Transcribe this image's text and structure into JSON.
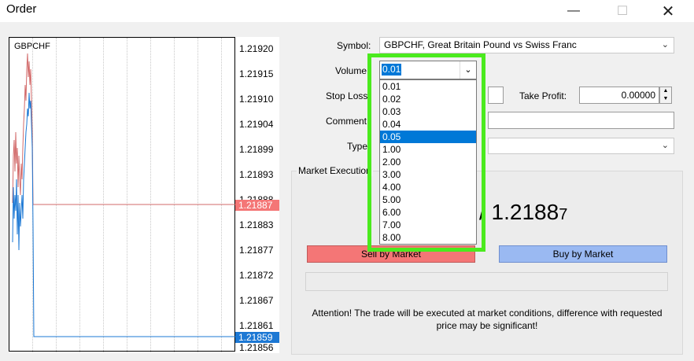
{
  "window": {
    "title": "Order",
    "minimize_icon": "minimize-icon",
    "maximize_icon": "maximize-icon",
    "close_icon": "close-icon"
  },
  "chart": {
    "symbol": "GBPCHF",
    "price_ticks": [
      "1.21920",
      "1.21915",
      "1.21910",
      "1.21904",
      "1.21899",
      "1.21893",
      "1.21888",
      "1.21883",
      "1.21877",
      "1.21872",
      "1.21867",
      "1.21861",
      "1.21856"
    ],
    "ask_tag": "1.21887",
    "bid_tag": "1.21859",
    "colors": {
      "ask": "#f47676",
      "bid": "#1c78d4"
    }
  },
  "form": {
    "symbol_label": "Symbol:",
    "symbol_value": "GBPCHF, Great Britain Pound vs Swiss Franc",
    "volume_label": "Volume:",
    "volume_value": "0.01",
    "stop_loss_label": "Stop Loss:",
    "take_profit_label": "Take Profit:",
    "take_profit_value": "0.00000",
    "comment_label": "Comment:",
    "type_label": "Type:"
  },
  "volume_options": [
    "0.01",
    "0.02",
    "0.03",
    "0.04",
    "0.05",
    "1.00",
    "2.00",
    "3.00",
    "4.00",
    "5.00",
    "6.00",
    "7.00",
    "8.00"
  ],
  "volume_highlighted": "0.05",
  "market": {
    "group_title": "Market Execution",
    "quote_visible": "/ 1.2188",
    "quote_last_digit": "7",
    "sell_button": "Sell by Market",
    "buy_button": "Buy by Market",
    "attention": "Attention! The trade will be executed at market conditions, difference with requested price may be significant!"
  },
  "accent": {
    "highlight_border": "#4bea1e",
    "selection": "#0078d7"
  }
}
